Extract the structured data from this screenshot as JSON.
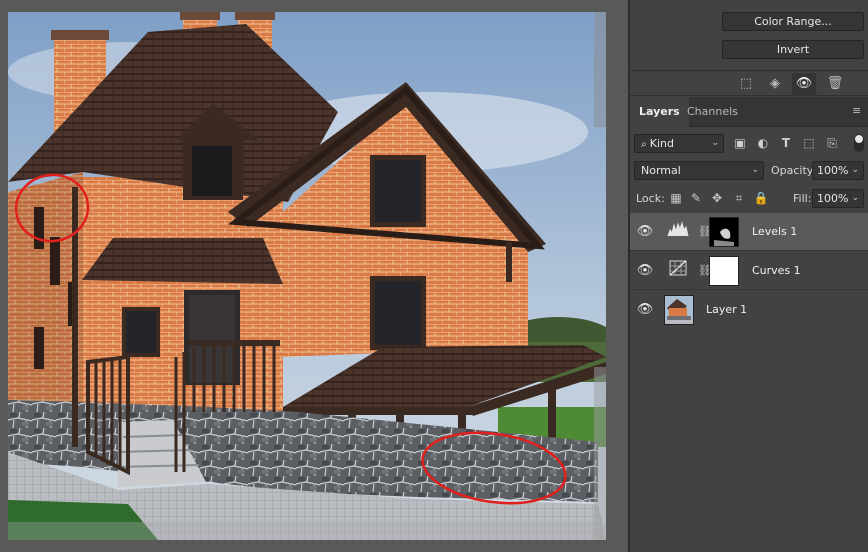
{
  "adjustments": {
    "color_range_label": "Color Range...",
    "invert_label": "Invert"
  },
  "panel_tabs": {
    "layers": "Layers",
    "channels": "Channels"
  },
  "filter": {
    "kind_label": "Kind"
  },
  "blend": {
    "mode": "Normal",
    "opacity_label": "Opacity:",
    "opacity_value": "100%"
  },
  "lock": {
    "label": "Lock:",
    "fill_label": "Fill:",
    "fill_value": "100%"
  },
  "layers": [
    {
      "name": "Levels 1",
      "type": "levels-adjustment",
      "visible": true,
      "selected": true
    },
    {
      "name": "Curves 1",
      "type": "curves-adjustment",
      "visible": true,
      "selected": false
    },
    {
      "name": "Layer 1",
      "type": "image",
      "visible": true,
      "selected": false
    }
  ],
  "colors": {
    "panel_bg": "#424242",
    "selected_layer": "#5a5a5a",
    "annotation_red": "#e0201c"
  }
}
